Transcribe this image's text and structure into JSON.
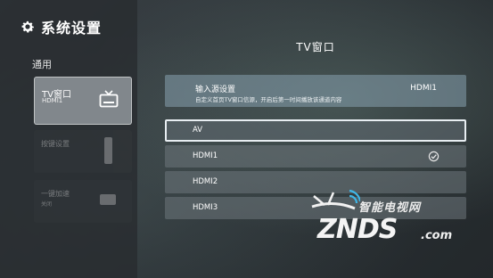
{
  "app": {
    "title": "系统设置"
  },
  "sidebar": {
    "section": "通用",
    "cards": [
      {
        "title": "TV窗口",
        "subtitle": "HDMI1"
      },
      {
        "title": "按键设置",
        "subtitle": ""
      },
      {
        "title": "一键加速",
        "subtitle": "关闭"
      }
    ]
  },
  "panel": {
    "title": "TV窗口",
    "source": {
      "label": "输入源设置",
      "description": "自定义首页TV窗口信源，开启后第一时间播放该通道内容",
      "value": "HDMI1"
    },
    "options": [
      {
        "label": "AV",
        "selected": false
      },
      {
        "label": "HDMI1",
        "selected": true
      },
      {
        "label": "HDMI2",
        "selected": false
      },
      {
        "label": "HDMI3",
        "selected": false
      }
    ]
  },
  "watermark": {
    "cn": "智能电视网",
    "main": "ZNDS",
    "suffix": ".com"
  },
  "icons": [
    "gear-icon",
    "tv-icon",
    "check-icon"
  ]
}
